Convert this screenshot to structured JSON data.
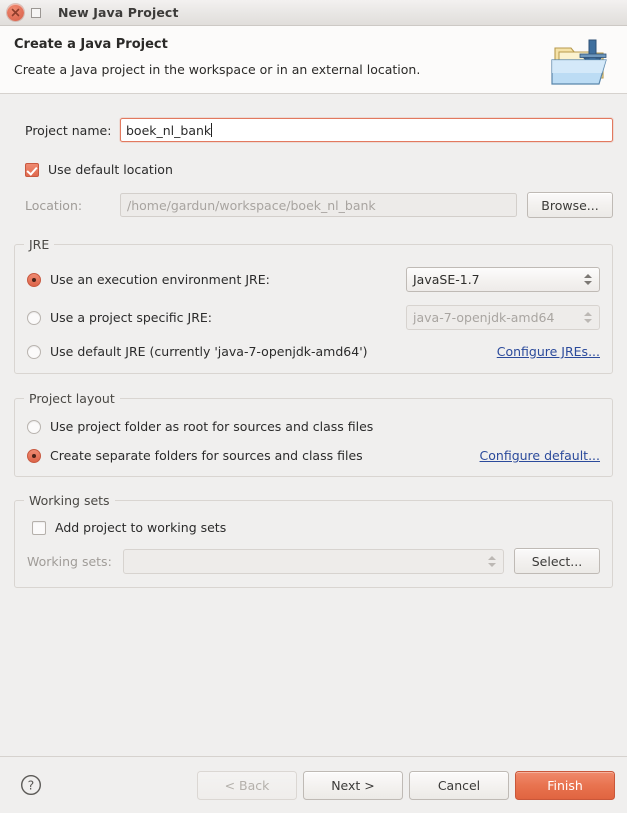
{
  "window": {
    "title": "New Java Project",
    "close_icon": "close-icon",
    "maximize_icon": "maximize-icon"
  },
  "header": {
    "title": "Create a Java Project",
    "description": "Create a Java project in the workspace or in an external location.",
    "icon": "java-project-folder-icon"
  },
  "form": {
    "project_name_label": "Project name:",
    "project_name_value": "boek_nl_bank",
    "use_default_location_label": "Use default location",
    "use_default_location_checked": true,
    "location_label": "Location:",
    "location_value": "/home/gardun/workspace/boek_nl_bank",
    "browse_label": "Browse..."
  },
  "jre": {
    "group_title": "JRE",
    "option_execution_env_label": "Use an execution environment JRE:",
    "option_execution_env_selected": true,
    "execution_env_value": "JavaSE-1.7",
    "option_project_specific_label": "Use a project specific JRE:",
    "option_project_specific_selected": false,
    "project_specific_value": "java-7-openjdk-amd64",
    "option_default_jre_label": "Use default JRE (currently 'java-7-openjdk-amd64')",
    "option_default_jre_selected": false,
    "configure_jres_link": "Configure JREs..."
  },
  "project_layout": {
    "group_title": "Project layout",
    "option_project_folder_root_label": "Use project folder as root for sources and class files",
    "option_project_folder_root_selected": false,
    "option_separate_folders_label": "Create separate folders for sources and class files",
    "option_separate_folders_selected": true,
    "configure_default_link": "Configure default..."
  },
  "working_sets": {
    "group_title": "Working sets",
    "add_project_label": "Add project to working sets",
    "add_project_checked": false,
    "working_sets_label": "Working sets:",
    "working_sets_value": "",
    "select_label": "Select..."
  },
  "footer": {
    "help_icon": "help-icon",
    "back_label": "< Back",
    "next_label": "Next >",
    "cancel_label": "Cancel",
    "finish_label": "Finish"
  },
  "colors": {
    "accent": "#e0674a",
    "link": "#2b4a9b",
    "window_bg": "#f0efee",
    "header_bg": "#fcfbfa",
    "focus_border": "#e2795f"
  }
}
